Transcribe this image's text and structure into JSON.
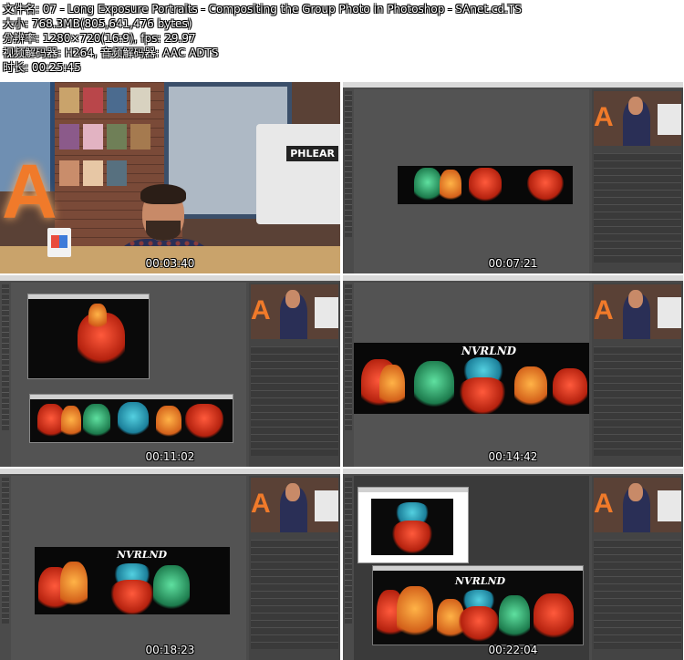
{
  "info": {
    "filename": "文件名: 07 - Long Exposure Portraits - Compositing the Group Photo in Photoshop - SAnet.cd.TS",
    "size": "大小: 768.3MB(805,641,476 bytes)",
    "resolution": "分辨率: 1280×720(16:9), fps: 29.97",
    "codec": "视频解码器: H264, 音频解码器: AAC ADTS",
    "duration": "时长: 00:25:45"
  },
  "thumbnails": [
    {
      "timestamp": "00:03:40"
    },
    {
      "timestamp": "00:07:21"
    },
    {
      "timestamp": "00:11:02"
    },
    {
      "timestamp": "00:14:42"
    },
    {
      "timestamp": "00:18:23"
    },
    {
      "timestamp": "00:22:04"
    }
  ],
  "studio": {
    "monitor_label": "PHLEAR"
  },
  "logo_text": "NVRLND"
}
